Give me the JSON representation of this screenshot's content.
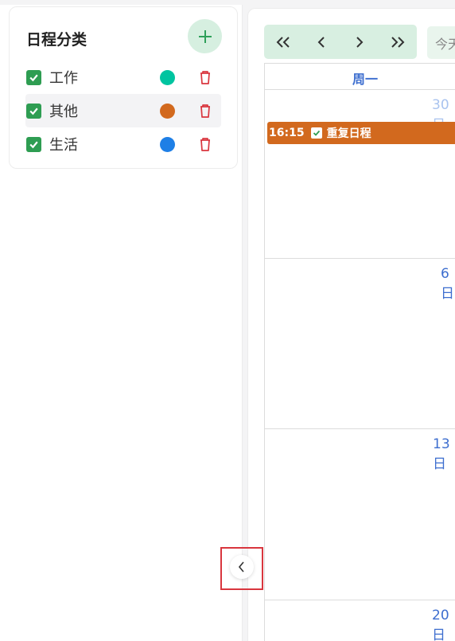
{
  "sidebar": {
    "title": "日程分类",
    "add_label": "+",
    "categories": [
      {
        "name": "工作",
        "color": "#00c4a0",
        "checked": true
      },
      {
        "name": "其他",
        "color": "#d2691e",
        "checked": true
      },
      {
        "name": "生活",
        "color": "#1e7fe6",
        "checked": true
      }
    ]
  },
  "calendar": {
    "nav": {
      "first": "«",
      "prev": "‹",
      "next": "›",
      "last": "»"
    },
    "today_label": "今天",
    "weekday_header": "周一",
    "dates": [
      "30日",
      "6日",
      "13日",
      "20日"
    ],
    "event": {
      "time": "16:15",
      "title": "重复日程",
      "color": "#d2691e"
    }
  },
  "colors": {
    "accent_green": "#2e9d52",
    "link_blue": "#3d6ecf",
    "delete_red": "#d9363e"
  }
}
